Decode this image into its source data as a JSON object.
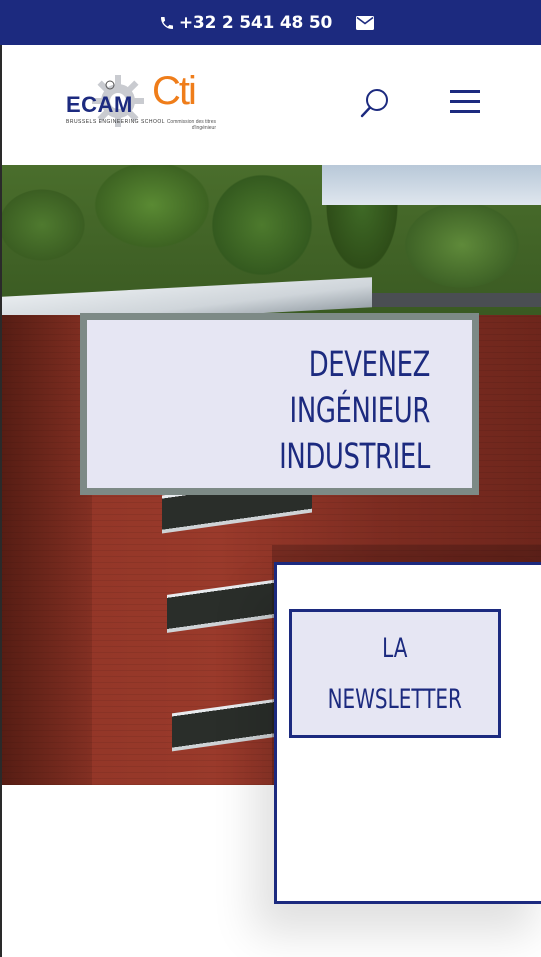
{
  "topbar": {
    "phone": "+32 2 541 48 50",
    "phone_icon": "phone-icon",
    "mail_icon": "envelope-icon",
    "background": "#1c2a7f"
  },
  "header": {
    "logo_ecam": {
      "name": "ECAM",
      "subtitle": "BRUSSELS ENGINEERING SCHOOL"
    },
    "logo_cti": {
      "name": "Cti",
      "subtitle": "Commission des titres d'ingénieur"
    },
    "search_icon": "search-icon",
    "menu_icon": "hamburger-menu-icon"
  },
  "hero": {
    "headline": "DEVENEZ INGÉNIEUR\nINDUSTRIEL"
  },
  "newsletter": {
    "label": "LA\nNEWSLETTER"
  },
  "colors": {
    "primary": "#1c2a7f",
    "card_bg": "#e6e6f3",
    "card_border": "#7d8a86",
    "cti_orange": "#ef7d1a"
  }
}
